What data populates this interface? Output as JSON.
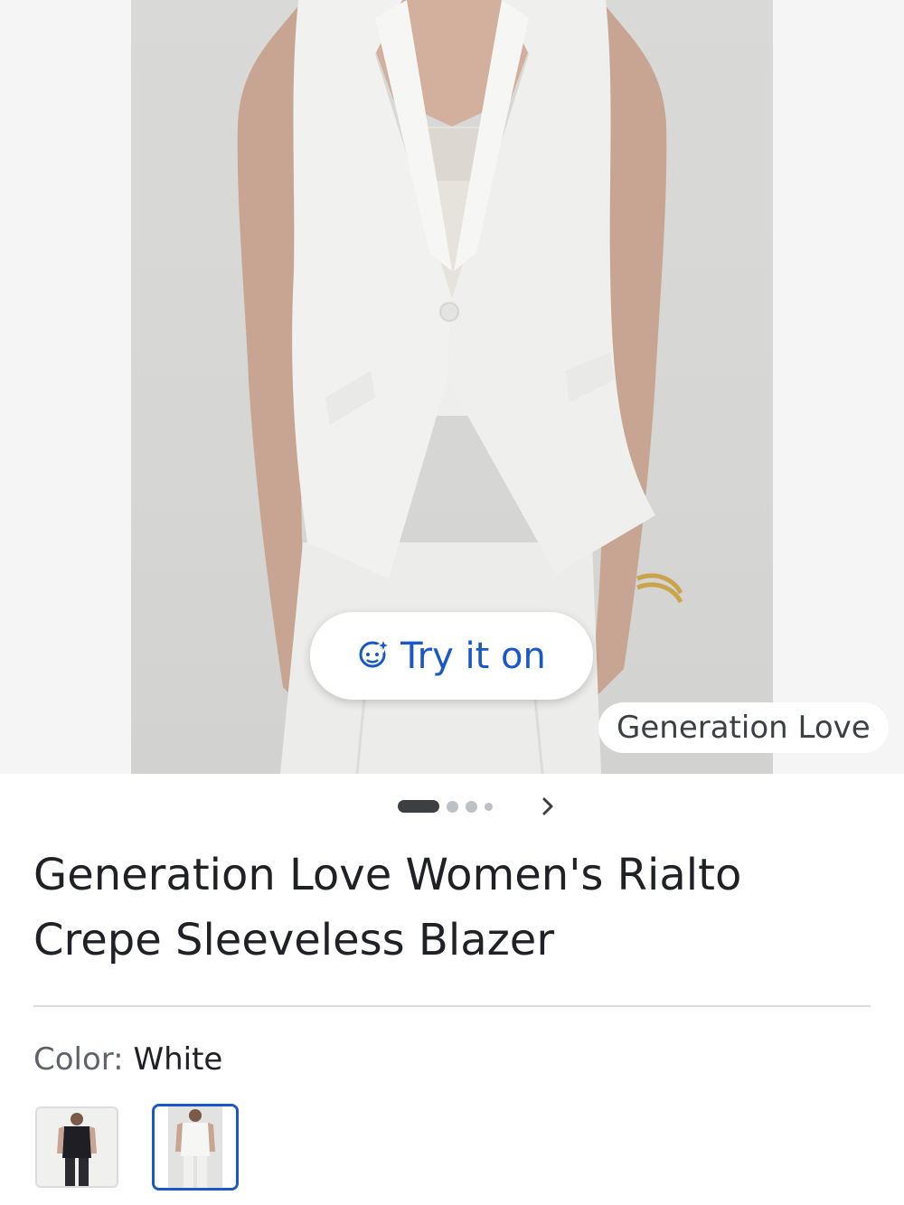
{
  "product": {
    "title_line1": "Generation Love Women's Rialto",
    "title_line2": "Crepe Sleeveless Blazer",
    "brand_badge": "Generation Love",
    "try_on_label": "Try it on",
    "color_label": "Color:",
    "color_value": "White",
    "swatches": [
      "Black",
      "White"
    ],
    "selected_swatch": "White"
  },
  "carousel": {
    "active_index": 0,
    "dot_count": 4,
    "next_icon": "chevron-right-icon"
  },
  "icons": {
    "try_on_icon": "face-sparkle-icon"
  },
  "colors": {
    "accent": "#1a57c9",
    "text": "#202124",
    "muted": "#5f6368"
  }
}
